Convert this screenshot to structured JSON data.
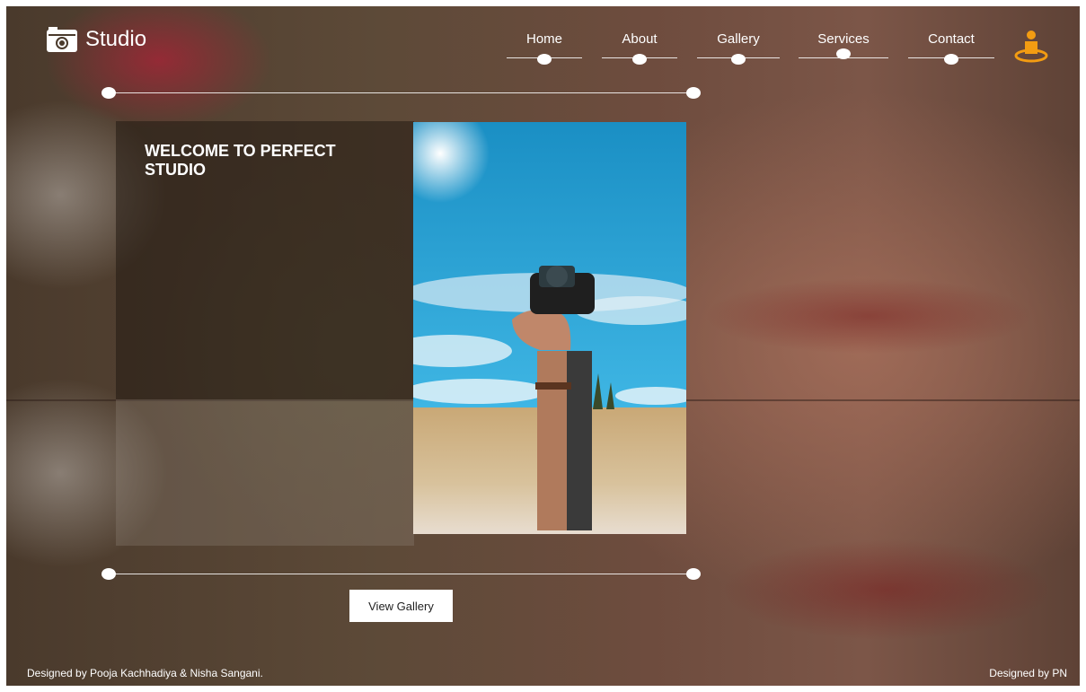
{
  "brand": {
    "name": "Studio",
    "icon": "camera-icon"
  },
  "nav": {
    "items": [
      {
        "label": "Home"
      },
      {
        "label": "About"
      },
      {
        "label": "Gallery"
      },
      {
        "label": "Services"
      },
      {
        "label": "Contact"
      }
    ],
    "user_icon": "user-location-icon"
  },
  "hero": {
    "heading": "WELCOME TO PERFECT STUDIO",
    "button_label": "View Gallery",
    "photo": "hand-holding-camera-in-wheat-field"
  },
  "footer": {
    "left": "Designed by Pooja Kachhadiya & Nisha Sangani.",
    "right": "Designed by PN"
  },
  "colors": {
    "accent": "#f39c12",
    "text": "#ffffff",
    "button_bg": "#ffffff"
  }
}
